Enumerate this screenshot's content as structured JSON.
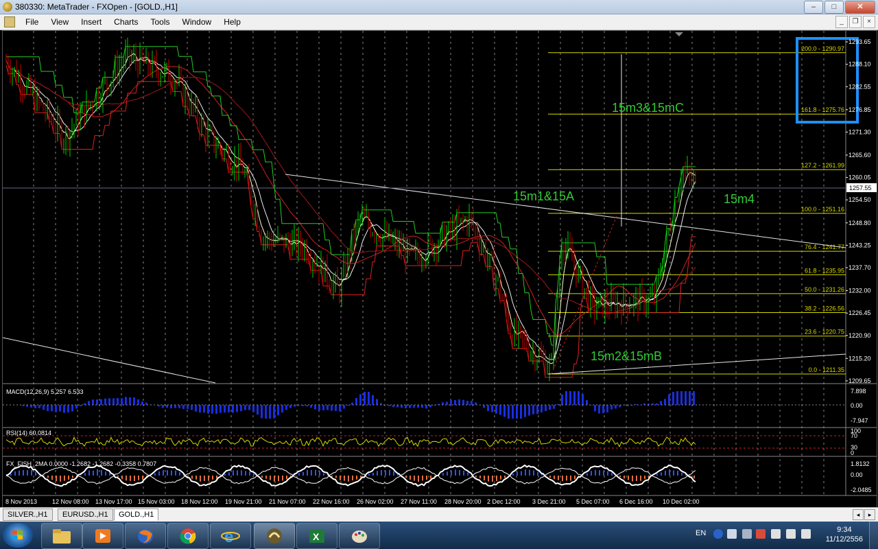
{
  "window": {
    "title": "380330: MetaTrader - FXOpen - [GOLD.,H1]",
    "minimize": "‒",
    "maximize": "□",
    "close": "✕"
  },
  "menu": {
    "items": [
      "File",
      "View",
      "Insert",
      "Charts",
      "Tools",
      "Window",
      "Help"
    ]
  },
  "mdi": {
    "minimize": "_",
    "restore": "❐",
    "close": "×"
  },
  "chart": {
    "symbol": "GOLD.,H1",
    "price_axis": [
      "1293.65",
      "1288.10",
      "1282.55",
      "1276.85",
      "1271.30",
      "1265.60",
      "1260.05",
      "1254.50",
      "1248.80",
      "1243.25",
      "1237.70",
      "1232.00",
      "1226.45",
      "1220.90",
      "1215.20",
      "1209.65"
    ],
    "current_price": "1257.55",
    "fib_levels": [
      "200.0 - 1290.97",
      "161.8 - 1275.76",
      "127.2 - 1261.99",
      "100.0 - 1251.16",
      "76.4 - 1241.77",
      "61.8 - 1235.95",
      "50.0 - 1231.26",
      "38.2 - 1226.56",
      "23.6 - 1220.75",
      "0.0 - 1211.35"
    ],
    "annotations": [
      "15m3&15mC",
      "15m1&15A",
      "15m4",
      "15m2&15mB"
    ],
    "time_axis": [
      "8 Nov 2013",
      "12 Nov 08:00",
      "13 Nov 17:00",
      "15 Nov 03:00",
      "18 Nov 12:00",
      "19 Nov 21:00",
      "21 Nov 07:00",
      "22 Nov 16:00",
      "26 Nov 02:00",
      "27 Nov 11:00",
      "28 Nov 20:00",
      "2 Dec 12:00",
      "3 Dec 21:00",
      "5 Dec 07:00",
      "6 Dec 16:00",
      "10 Dec 02:00"
    ],
    "colors": {
      "fib": "#d8d800",
      "annotation": "#33cc33",
      "highlight_box": "#1e90ff",
      "up_candle": "#00cc00",
      "down_candle": "#cc0000"
    }
  },
  "indicators": {
    "macd": {
      "label": "MACD(12,26,9) 5.257 6.533",
      "axis": [
        "7.898",
        "0.00",
        "-7.947"
      ]
    },
    "rsi": {
      "label": "RSI(14) 60.0814",
      "axis": [
        "100",
        "70",
        "30",
        "0"
      ]
    },
    "fish": {
      "label": "FX_FISH_2MA 0.0000 -1.2682 -1.2682 -0.3358 0.7807",
      "axis": [
        "1.8132",
        "0.00",
        "-2.0485"
      ]
    }
  },
  "tabs": [
    {
      "label": "SILVER.,H1",
      "active": false
    },
    {
      "label": "EURUSD.,H1",
      "active": false
    },
    {
      "label": "GOLD.,H1",
      "active": true
    }
  ],
  "taskbar": {
    "lang": "EN",
    "time": "9:34",
    "date": "11/12/2556"
  }
}
